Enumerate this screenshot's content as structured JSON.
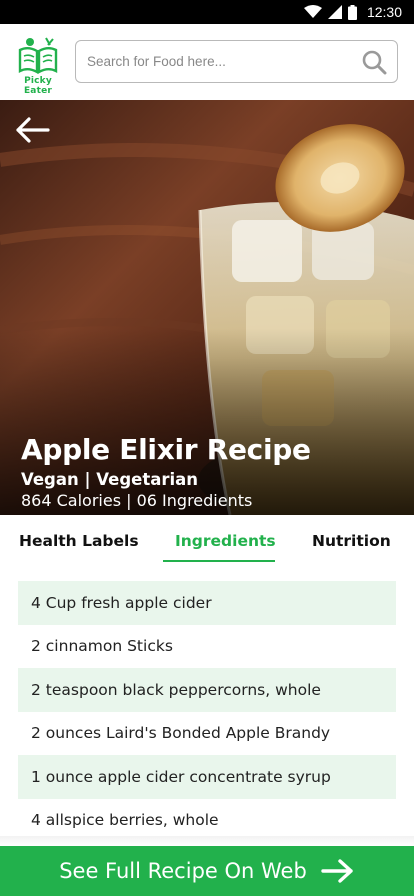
{
  "status_bar": {
    "time": "12:30"
  },
  "header": {
    "logo_text": "Picky Eater",
    "search": {
      "placeholder": "Search for Food here...",
      "value": ""
    }
  },
  "hero": {
    "title": "Apple Elixir Recipe",
    "diet_labels": "Vegan | Vegetarian",
    "meta": "864 Calories | 06 Ingredients"
  },
  "tabs": [
    {
      "label": "Health Labels",
      "active": false
    },
    {
      "label": "Ingredients",
      "active": true
    },
    {
      "label": "Nutrition",
      "active": false
    }
  ],
  "ingredients": [
    "4 Cup fresh apple cider",
    "2 cinnamon Sticks",
    "2 teaspoon black peppercorns, whole",
    "2 ounces Laird's Bonded Apple Brandy",
    "1 ounce apple cider concentrate syrup",
    "4 allspice berries, whole"
  ],
  "cta": {
    "label": "See Full Recipe On Web"
  },
  "colors": {
    "accent": "#22b14c",
    "row_tint": "#e9f6ec",
    "status_bar": "#000000"
  }
}
